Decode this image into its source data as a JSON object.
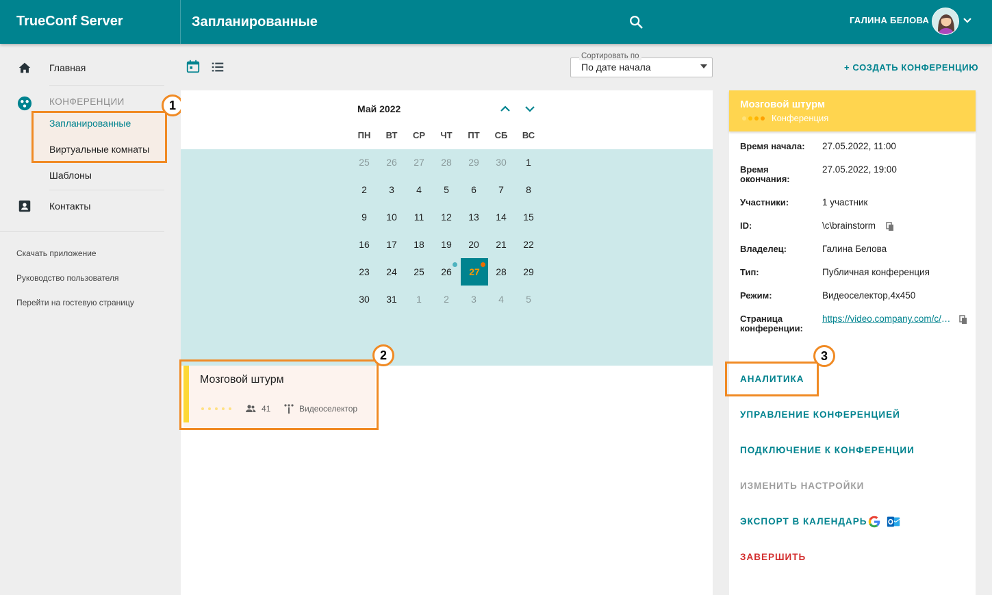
{
  "header": {
    "brand": "TrueConf Server",
    "title": "Запланированные",
    "user_name": "ГАЛИНА БЕЛОВА"
  },
  "sidebar": {
    "home": "Главная",
    "conferences": "КОНФЕРЕНЦИИ",
    "scheduled": "Запланированные",
    "virtual_rooms": "Виртуальные комнаты",
    "templates": "Шаблоны",
    "contacts": "Контакты",
    "links": [
      "Скачать приложение",
      "Руководство пользователя",
      "Перейти на гостевую страницу"
    ]
  },
  "toolbar": {
    "sort_label": "Сортировать по",
    "sort_value": "По дате начала",
    "create": "+ СОЗДАТЬ КОНФЕРЕНЦИЮ"
  },
  "calendar": {
    "month": "Май 2022",
    "weekdays": [
      "ПН",
      "ВТ",
      "СР",
      "ЧТ",
      "ПТ",
      "СБ",
      "ВС"
    ],
    "weeks": [
      [
        "25",
        "26",
        "27",
        "28",
        "29",
        "30",
        "1"
      ],
      [
        "2",
        "3",
        "4",
        "5",
        "6",
        "7",
        "8"
      ],
      [
        "9",
        "10",
        "11",
        "12",
        "13",
        "14",
        "15"
      ],
      [
        "16",
        "17",
        "18",
        "19",
        "20",
        "21",
        "22"
      ],
      [
        "23",
        "24",
        "25",
        "26",
        "27",
        "28",
        "29"
      ],
      [
        "30",
        "31",
        "1",
        "2",
        "3",
        "4",
        "5"
      ]
    ],
    "selected_day": "27"
  },
  "event": {
    "title": "Мозговой штурм",
    "participants": "41",
    "mode": "Видеоселектор"
  },
  "details": {
    "title": "Мозговой штурм",
    "subtitle": "Конференция",
    "rows": [
      {
        "label": "Время начала:",
        "value": "27.05.2022, 11:00"
      },
      {
        "label": "Время окончания:",
        "value": "27.05.2022, 19:00"
      },
      {
        "label": "Участники:",
        "value": "1 участник"
      },
      {
        "label": "ID:",
        "value": "\\c\\brainstorm"
      },
      {
        "label": "Владелец:",
        "value": "Галина Белова"
      },
      {
        "label": "Тип:",
        "value": "Публичная конференция"
      },
      {
        "label": "Режим:",
        "value": "Видеоселектор,4x450"
      },
      {
        "label": "Страница конференции:",
        "value": "https://video.company.com/c/brainstorm"
      }
    ],
    "actions": {
      "analytics": "АНАЛИТИКА",
      "manage": "УПРАВЛЕНИЕ КОНФЕРЕНЦИЕЙ",
      "connect": "ПОДКЛЮЧЕНИЕ К КОНФЕРЕНЦИИ",
      "edit": "ИЗМЕНИТЬ НАСТРОЙКИ",
      "export": "ЭКСПОРТ В КАЛЕНДАРЬ",
      "finish": "ЗАВЕРШИТЬ"
    }
  },
  "markers": [
    "1",
    "2",
    "3"
  ],
  "colors": {
    "primary": "#00838f",
    "accent_orange": "#f08a24",
    "event_yellow": "#ffd54f",
    "danger": "#d32f2f",
    "disabled": "#9e9e9e"
  }
}
